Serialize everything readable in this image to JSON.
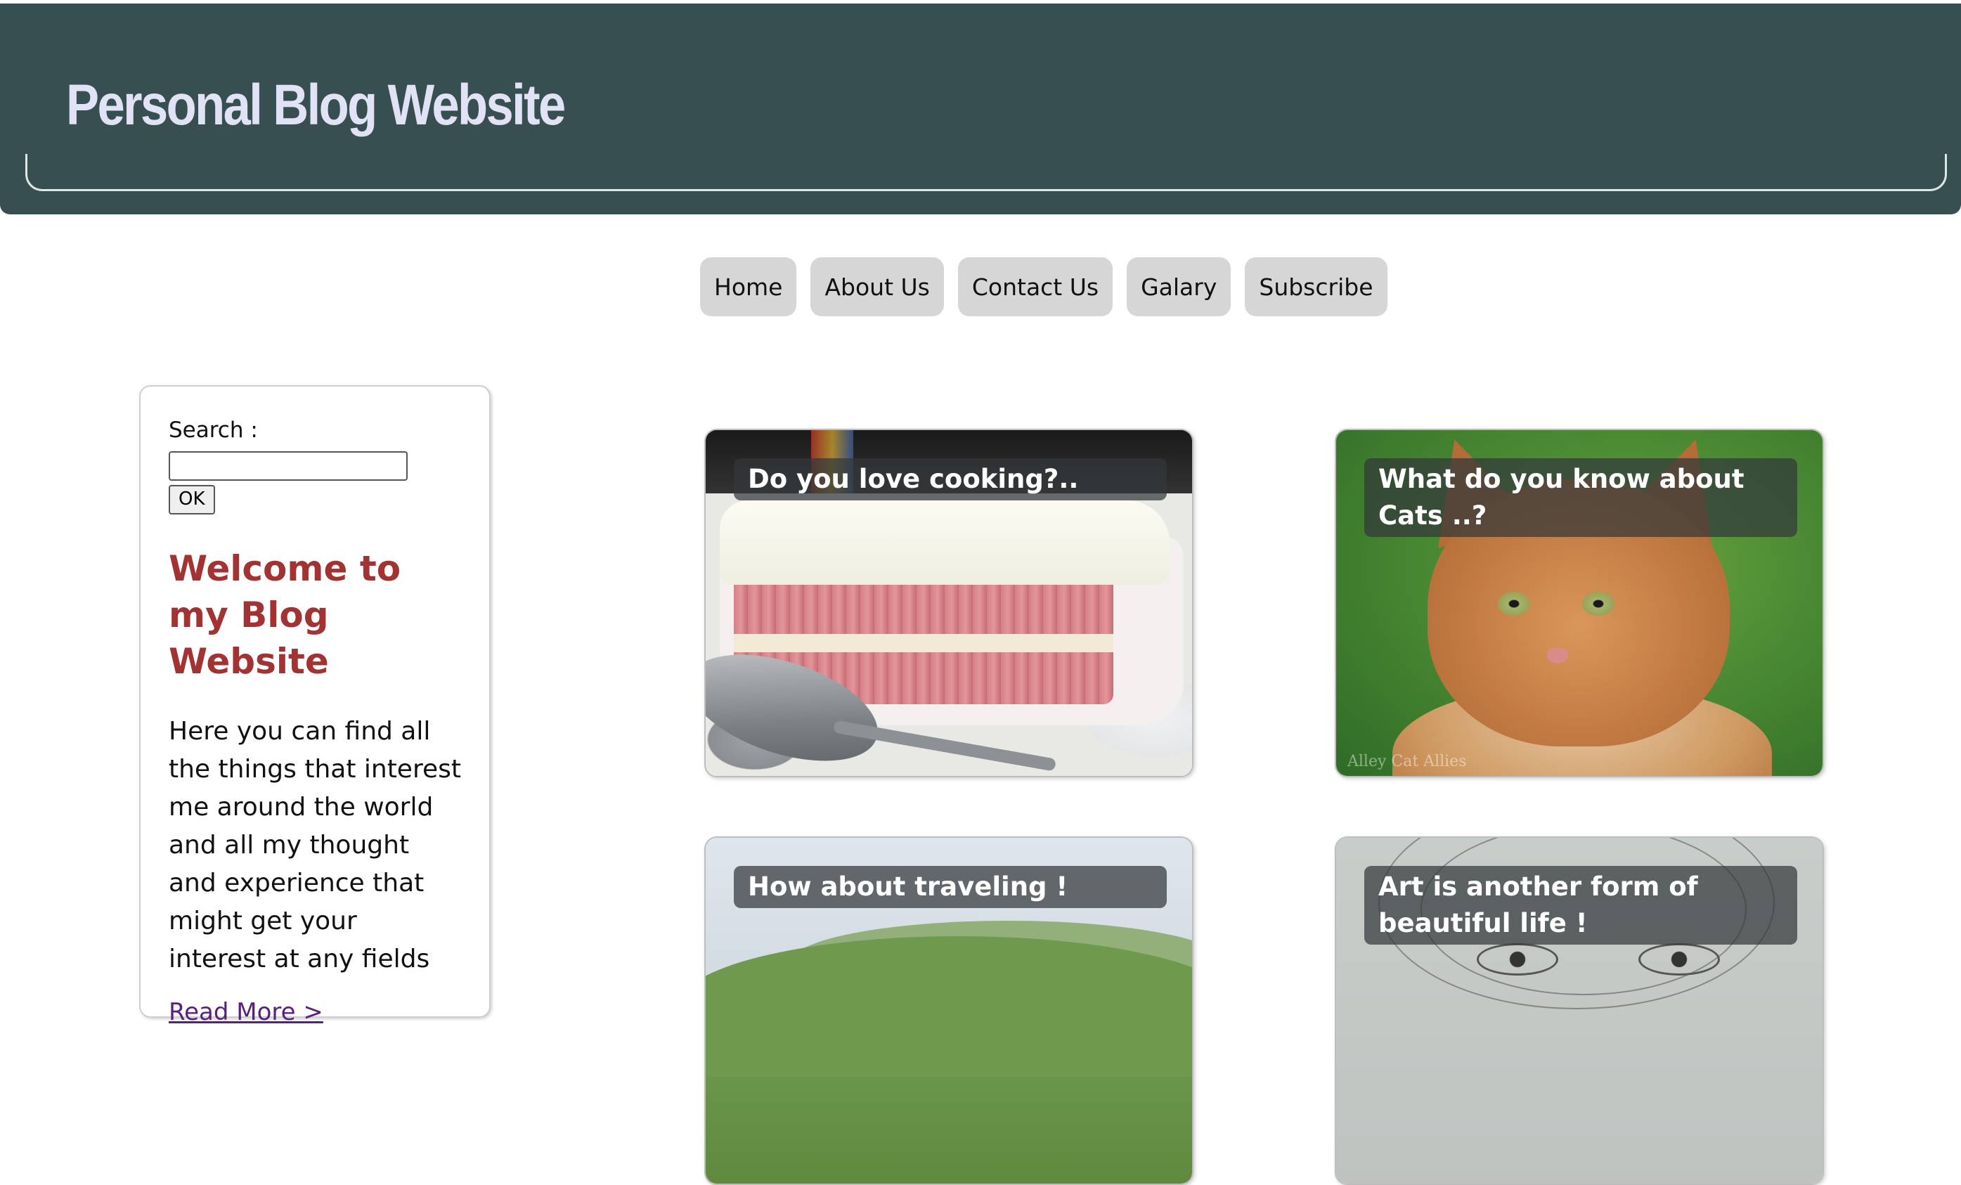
{
  "header": {
    "title": "Personal Blog Website"
  },
  "nav": {
    "items": [
      "Home",
      "About Us",
      "Contact Us",
      "Galary",
      "Subscribe"
    ]
  },
  "sidebar": {
    "search_label": "Search :",
    "search_value": "",
    "ok_label": "OK",
    "welcome_title": "Welcome to my Blog Website",
    "welcome_text": "Here you can find all the things that interest me around the world and all my thought and experience that might get your interest at any fields",
    "read_more": "Read More >"
  },
  "cards": [
    {
      "caption": "Do you love cooking?..",
      "image": "cake-photo"
    },
    {
      "caption": "What do you know about Cats ..?",
      "image": "cat-photo",
      "watermark": "Alley Cat Allies"
    },
    {
      "caption": "How about traveling !",
      "image": "landscape-photo"
    },
    {
      "caption": "Art is another form of beautiful life !",
      "image": "pencil-sketch"
    }
  ],
  "colors": {
    "header_bg": "#384f52",
    "header_title": "#e2e2f6",
    "nav_button_bg": "#d6d6d6",
    "welcome_title": "#a23332",
    "read_more_link": "#5a1f7c"
  }
}
